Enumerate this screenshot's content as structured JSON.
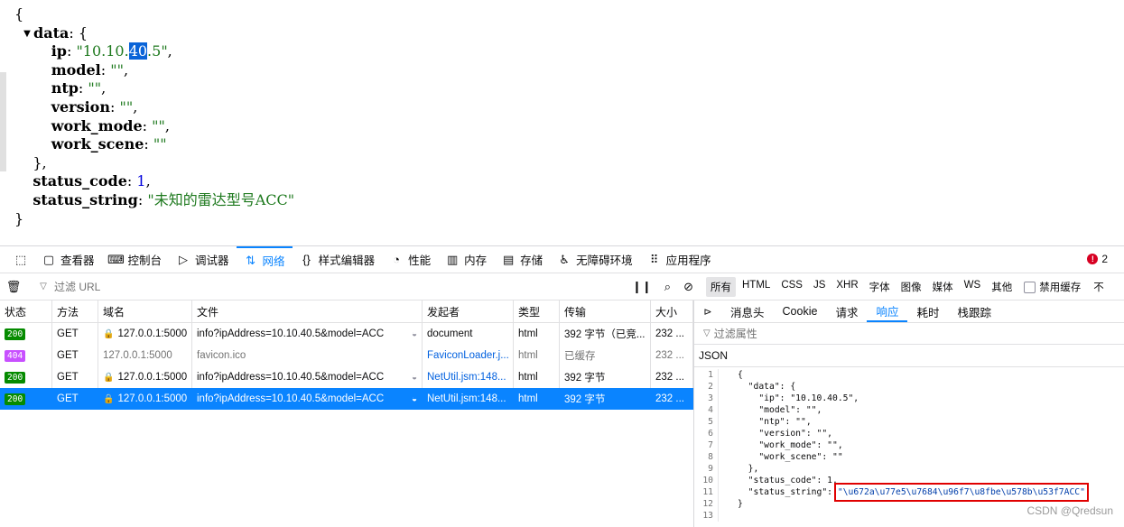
{
  "viewer": {
    "lines": [
      {
        "kind": "open",
        "text": "{"
      },
      {
        "kind": "objkey",
        "key": "data",
        "punct": ": {"
      },
      {
        "kind": "prop",
        "indent": "        ",
        "key": "ip",
        "sep": ": ",
        "pre": "\"10.10.",
        "sel": "40",
        ".": "",
        "post": ".5\"",
        "end": ","
      },
      {
        "kind": "prop",
        "indent": "        ",
        "key": "model",
        "sep": ": ",
        "pre": "\"\"",
        "sel": "",
        "post": "",
        "end": ","
      },
      {
        "kind": "prop",
        "indent": "        ",
        "key": "ntp",
        "sep": ": ",
        "pre": "\"\"",
        "sel": "",
        "post": "",
        "end": ","
      },
      {
        "kind": "prop",
        "indent": "        ",
        "key": "version",
        "sep": ": ",
        "pre": "\"\"",
        "sel": "",
        "post": "",
        "end": ","
      },
      {
        "kind": "prop",
        "indent": "        ",
        "key": "work_mode",
        "sep": ": ",
        "pre": "\"\"",
        "sel": "",
        "post": "",
        "end": ","
      },
      {
        "kind": "prop",
        "indent": "        ",
        "key": "work_scene",
        "sep": ": ",
        "pre": "\"\"",
        "sel": "",
        "post": "",
        "end": ""
      },
      {
        "kind": "plain",
        "text": "    },"
      },
      {
        "kind": "num",
        "indent": "    ",
        "key": "status_code",
        "sep": ": ",
        "val": "1",
        "end": ","
      },
      {
        "kind": "prop",
        "indent": "    ",
        "key": "status_string",
        "sep": ": ",
        "pre": "\"未知的雷达型号ACC\"",
        "sel": "",
        "post": "",
        "end": ""
      },
      {
        "kind": "open",
        "text": "}"
      }
    ]
  },
  "toolbar": {
    "tabs": [
      {
        "icon": "▢",
        "label": "查看器",
        "name": "tab-inspector",
        "active": false
      },
      {
        "icon": "⌨",
        "label": "控制台",
        "name": "tab-console",
        "active": false
      },
      {
        "icon": "▷",
        "label": "调试器",
        "name": "tab-debugger",
        "active": false
      },
      {
        "icon": "⇅",
        "label": "网络",
        "name": "tab-network",
        "active": true
      },
      {
        "icon": "{}",
        "label": "样式编辑器",
        "name": "tab-style-editor",
        "active": false
      },
      {
        "icon": "◔",
        "label": "性能",
        "name": "tab-performance",
        "active": false
      },
      {
        "icon": "▥",
        "label": "内存",
        "name": "tab-memory",
        "active": false
      },
      {
        "icon": "▤",
        "label": "存储",
        "name": "tab-storage",
        "active": false
      },
      {
        "icon": "♿",
        "label": "无障碍环境",
        "name": "tab-accessibility",
        "active": false
      },
      {
        "icon": "⠿",
        "label": "应用程序",
        "name": "tab-application",
        "active": false
      }
    ],
    "error_count": "2"
  },
  "filterbar": {
    "placeholder": "过滤 URL",
    "type_filters": [
      "所有",
      "HTML",
      "CSS",
      "JS",
      "XHR",
      "字体",
      "图像",
      "媒体",
      "WS",
      "其他"
    ],
    "active_filter": "所有",
    "disable_cache": "禁用缓存",
    "throttle": "不"
  },
  "requests": {
    "headers": [
      "状态",
      "方法",
      "域名",
      "文件",
      "发起者",
      "类型",
      "传输",
      "大小"
    ],
    "rows": [
      {
        "status": "200",
        "status_kind": "ok",
        "method": "GET",
        "secure": true,
        "domain": "127.0.0.1:5000",
        "file": "info?ipAddress=10.10.40.5&model=ACC",
        "initiator": "document",
        "initiator_link": false,
        "type": "html",
        "transfer": "392 字节（已竞...",
        "size": "232 ...",
        "selected": false
      },
      {
        "status": "404",
        "status_kind": "nf",
        "method": "GET",
        "secure": false,
        "domain": "127.0.0.1:5000",
        "file": "favicon.ico",
        "initiator": "FaviconLoader.j...",
        "initiator_link": true,
        "type": "html",
        "transfer": "已缓存",
        "size": "232 ...",
        "selected": false
      },
      {
        "status": "200",
        "status_kind": "ok",
        "method": "GET",
        "secure": true,
        "domain": "127.0.0.1:5000",
        "file": "info?ipAddress=10.10.40.5&model=ACC",
        "initiator": "NetUtil.jsm:148...",
        "initiator_link": true,
        "type": "html",
        "transfer": "392 字节",
        "size": "232 ...",
        "selected": false
      },
      {
        "status": "200",
        "status_kind": "ok",
        "method": "GET",
        "secure": true,
        "domain": "127.0.0.1:5000",
        "file": "info?ipAddress=10.10.40.5&model=ACC",
        "initiator": "NetUtil.jsm:148...",
        "initiator_link": true,
        "type": "html",
        "transfer": "392 字节",
        "size": "232 ...",
        "selected": true
      }
    ]
  },
  "detail": {
    "tabs": [
      "消息头",
      "Cookie",
      "请求",
      "响应",
      "耗时",
      "栈跟踪"
    ],
    "active_tab": "响应",
    "filter_placeholder": "过滤属性",
    "json_label": "JSON",
    "code": [
      {
        "n": "1",
        "t": "{"
      },
      {
        "n": "2",
        "t": "  \"data\": {"
      },
      {
        "n": "3",
        "t": "    \"ip\": \"10.10.40.5\","
      },
      {
        "n": "4",
        "t": "    \"model\": \"\","
      },
      {
        "n": "5",
        "t": "    \"ntp\": \"\","
      },
      {
        "n": "6",
        "t": "    \"version\": \"\","
      },
      {
        "n": "7",
        "t": "    \"work_mode\": \"\","
      },
      {
        "n": "8",
        "t": "    \"work_scene\": \"\""
      },
      {
        "n": "9",
        "t": "  },"
      },
      {
        "n": "10",
        "t": "  \"status_code\": 1,"
      },
      {
        "n": "11",
        "t": "  \"status_string\": ",
        "hl": "\"\\u672a\\u77e5\\u7684\\u96f7\\u8fbe\\u578b\\u53f7ACC\""
      },
      {
        "n": "12",
        "t": "}"
      },
      {
        "n": "13",
        "t": ""
      }
    ]
  },
  "watermark": "CSDN @Qredsun",
  "colors": {
    "accent": "#0a84ff",
    "ok": "#058b00",
    "not_found": "#c850ff",
    "highlight_box": "#e00000"
  }
}
